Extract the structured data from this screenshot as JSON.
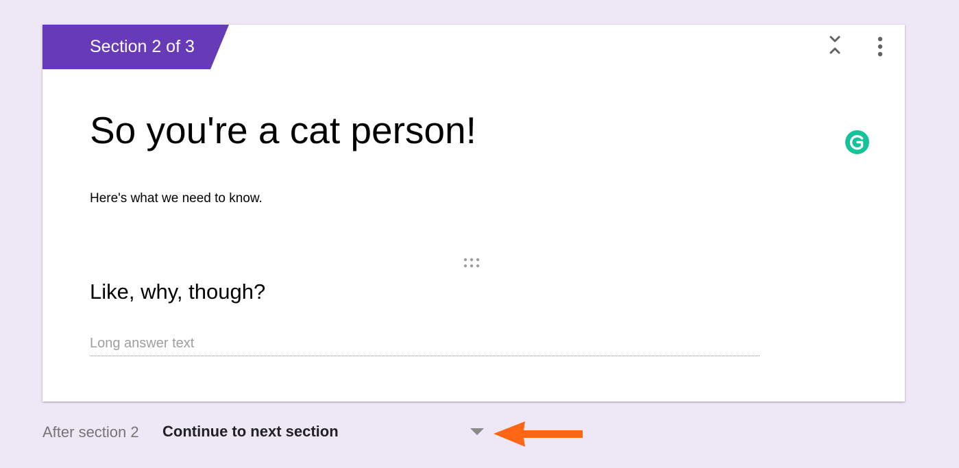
{
  "section": {
    "tab_label": "Section 2 of 3",
    "title": "So you're a cat person!",
    "description": "Here's what we need to know."
  },
  "question": {
    "title": "Like, why, though?",
    "placeholder": "Long answer text"
  },
  "footer": {
    "after_section_label": "After section 2",
    "navigation_value": "Continue to next section"
  },
  "icons": {
    "collapse": "collapse-expand-icon",
    "more": "more-vert-icon",
    "grammarly": "grammarly-icon",
    "drag": "drag-handle-icon",
    "dropdown": "dropdown-arrow-icon",
    "annotation": "orange-arrow-annotation-icon"
  },
  "colors": {
    "page_background": "#ede7f6",
    "section_accent": "#673ab7",
    "grammarly": "#15c39a",
    "annotation_arrow": "#ff6614"
  }
}
